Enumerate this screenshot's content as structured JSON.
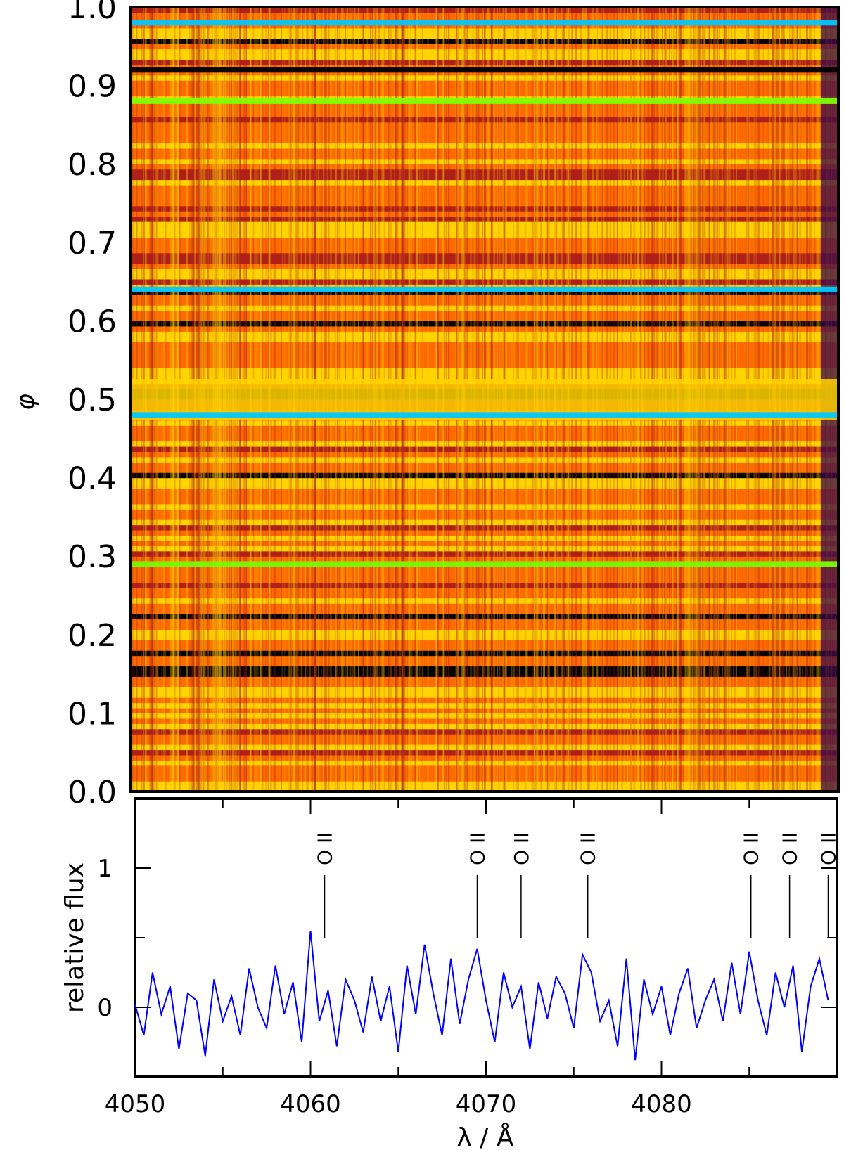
{
  "chart_data": [
    {
      "type": "heatmap",
      "title": "",
      "xlabel": "",
      "ylabel": "φ",
      "xlim": [
        4050,
        4090
      ],
      "ylim": [
        0.0,
        1.0
      ],
      "yticks": [
        "0.0",
        "0.1",
        "0.2",
        "0.3",
        "0.4",
        "0.5",
        "0.6",
        "0.7",
        "0.8",
        "0.9",
        "1.0"
      ],
      "colormap": [
        "#000000",
        "#3a0a4a",
        "#b0201a",
        "#ff6a00",
        "#ffd400",
        "#7fff00",
        "#00c8ff"
      ],
      "features": [
        {
          "phase": 0.98,
          "color": "#00c8ff"
        },
        {
          "phase": 0.92,
          "color": "#000000"
        },
        {
          "phase": 0.88,
          "color": "#7fff00"
        },
        {
          "phase": 0.64,
          "color": "#00c8ff"
        },
        {
          "phase": 0.5,
          "color": "#ffd400"
        },
        {
          "phase": 0.48,
          "color": "#00c8ff"
        },
        {
          "phase": 0.29,
          "color": "#7fff00"
        }
      ]
    },
    {
      "type": "line",
      "title": "",
      "xlabel": "λ / Å",
      "ylabel": "relative flux",
      "xlim": [
        4050,
        4090
      ],
      "ylim": [
        -0.5,
        1.5
      ],
      "xticks": [
        "4050",
        "4060",
        "4070",
        "4080"
      ],
      "yticks": [
        "0",
        "1"
      ],
      "series_color": "#0000ff",
      "line_markers": [
        {
          "label": "O II",
          "x": 4060.8
        },
        {
          "label": "O II",
          "x": 4069.5
        },
        {
          "label": "O II",
          "x": 4072.0
        },
        {
          "label": "O II",
          "x": 4075.8
        },
        {
          "label": "O II",
          "x": 4085.1
        },
        {
          "label": "O II",
          "x": 4087.3
        },
        {
          "label": "O II",
          "x": 4089.5
        }
      ],
      "series": [
        {
          "x": [
            4050.0,
            4050.5,
            4051.0,
            4051.5,
            4052.0,
            4052.5,
            4053.0,
            4053.5,
            4054.0,
            4054.5,
            4055.0,
            4055.5,
            4056.0,
            4056.5,
            4057.0,
            4057.5,
            4058.0,
            4058.5,
            4059.0,
            4059.5,
            4060.0,
            4060.5,
            4061.0,
            4061.5,
            4062.0,
            4062.5,
            4063.0,
            4063.5,
            4064.0,
            4064.5,
            4065.0,
            4065.5,
            4066.0,
            4066.5,
            4067.0,
            4067.5,
            4068.0,
            4068.5,
            4069.0,
            4069.5,
            4070.0,
            4070.5,
            4071.0,
            4071.5,
            4072.0,
            4072.5,
            4073.0,
            4073.5,
            4074.0,
            4074.5,
            4075.0,
            4075.5,
            4076.0,
            4076.5,
            4077.0,
            4077.5,
            4078.0,
            4078.5,
            4079.0,
            4079.5,
            4080.0,
            4080.5,
            4081.0,
            4081.5,
            4082.0,
            4082.5,
            4083.0,
            4083.5,
            4084.0,
            4084.5,
            4085.0,
            4085.5,
            4086.0,
            4086.5,
            4087.0,
            4087.5,
            4088.0,
            4088.5,
            4089.0,
            4089.5
          ],
          "y": [
            0.02,
            -0.2,
            0.25,
            -0.05,
            0.15,
            -0.3,
            0.1,
            0.05,
            -0.35,
            0.2,
            -0.1,
            0.08,
            -0.2,
            0.28,
            0.0,
            -0.15,
            0.3,
            -0.05,
            0.18,
            -0.25,
            0.55,
            -0.1,
            0.12,
            -0.28,
            0.2,
            0.05,
            -0.18,
            0.22,
            -0.1,
            0.15,
            -0.32,
            0.3,
            -0.05,
            0.45,
            0.1,
            -0.2,
            0.35,
            -0.12,
            0.2,
            0.42,
            0.05,
            -0.25,
            0.25,
            0.0,
            0.15,
            -0.3,
            0.18,
            -0.08,
            0.22,
            0.1,
            -0.15,
            0.38,
            0.25,
            -0.1,
            0.05,
            -0.28,
            0.35,
            -0.38,
            0.2,
            -0.05,
            0.15,
            -0.2,
            0.1,
            0.28,
            -0.15,
            0.05,
            0.2,
            -0.1,
            0.32,
            -0.05,
            0.4,
            0.05,
            -0.2,
            0.25,
            0.0,
            0.3,
            -0.32,
            0.15,
            0.35,
            0.05
          ]
        }
      ]
    }
  ]
}
